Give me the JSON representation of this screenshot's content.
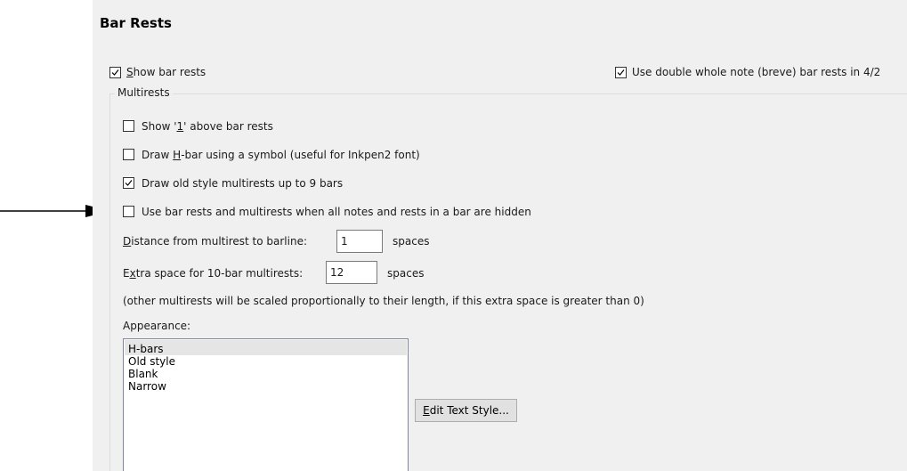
{
  "section_title": "Bar Rests",
  "show_bar_rests": {
    "label_pre": "",
    "label_key": "S",
    "label_post": "how bar rests",
    "checked": true
  },
  "double_whole": {
    "label": "Use double whole note (breve) bar rests in 4/2",
    "checked": true
  },
  "multirests": {
    "group_label": "Multirests",
    "options": [
      {
        "pre": "Show '",
        "key": "1",
        "post": "' above bar rests",
        "checked": false
      },
      {
        "pre": "Draw ",
        "key": "H",
        "post": "-bar using a symbol (useful for Inkpen2 font)",
        "checked": false
      },
      {
        "pre": "Draw old style multirests up to 9 bars",
        "key": "",
        "post": "",
        "checked": true
      },
      {
        "pre": "Use bar rests and multirests when all notes and rests in a bar are hidden",
        "key": "",
        "post": "",
        "checked": false
      }
    ],
    "distance": {
      "label_key": "D",
      "label_post": "istance from multirest to barline:",
      "value": "1",
      "unit": "spaces"
    },
    "extra": {
      "label_pre": "E",
      "label_key": "x",
      "label_post": "tra space for 10-bar multirests:",
      "value": "12",
      "unit": "spaces"
    },
    "note": "(other multirests will be scaled proportionally to their length, if this extra space is greater than 0)",
    "appearance_label": "Appearance:",
    "appearance_options": [
      "H-bars",
      "Old style",
      "Blank",
      "Narrow"
    ],
    "appearance_selected": "H-bars",
    "edit_text_style": {
      "key": "E",
      "post": "dit Text Style..."
    }
  },
  "colors": {
    "panel": "#f0f0f0",
    "selection": "#e5e5e5"
  },
  "icons": {
    "arrow": "right-arrow-icon",
    "check": "checkmark-icon"
  }
}
